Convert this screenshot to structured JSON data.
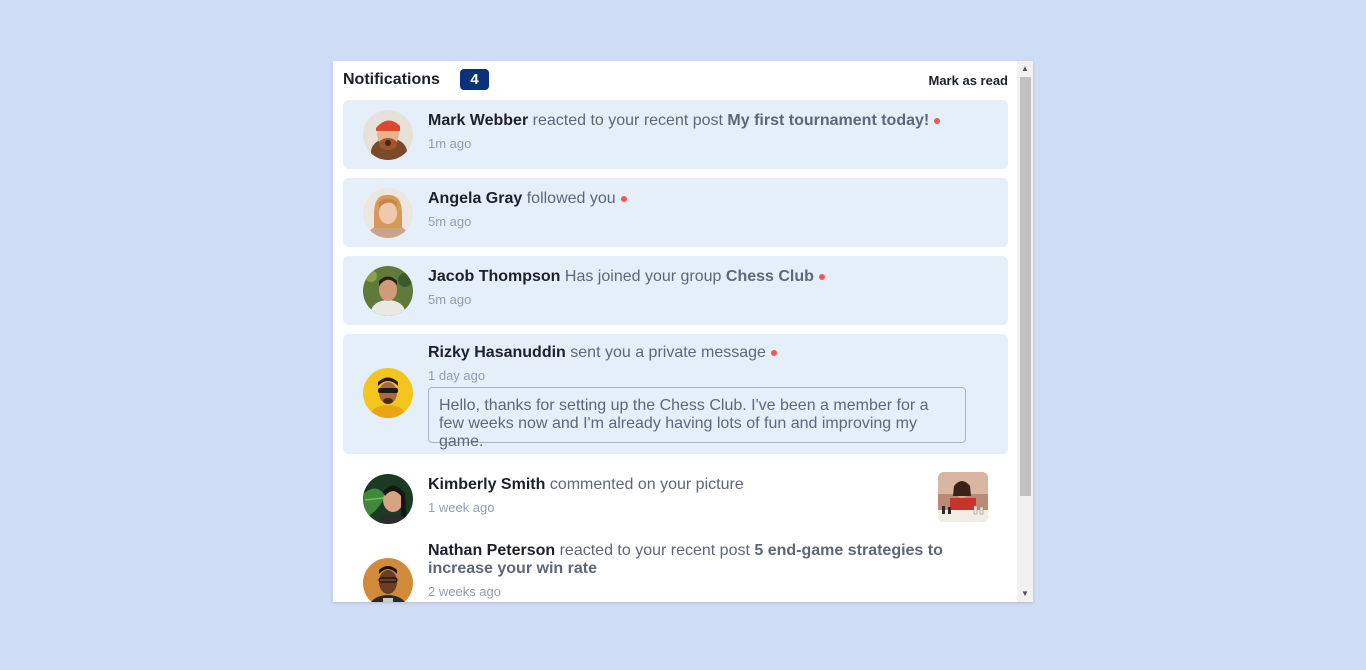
{
  "header": {
    "title": "Notifications",
    "unread_count": "4",
    "mark_read_label": "Mark as read"
  },
  "colors": {
    "background": "#cfdcf6",
    "unread_bg": "#e5effa",
    "badge": "#0a327b",
    "dot": "#f65552",
    "dark_text": "#1c202b",
    "muted_text": "#5e6778"
  },
  "notifications": [
    {
      "name": "Mark Webber",
      "action": "reacted to your recent post",
      "target": "My first tournament today!",
      "time": "1m ago",
      "unread": true
    },
    {
      "name": "Angela Gray",
      "action": "followed you",
      "target": "",
      "time": "5m ago",
      "unread": true
    },
    {
      "name": "Jacob Thompson",
      "action": "Has joined your group",
      "target": "Chess Club",
      "time": "5m ago",
      "unread": true
    },
    {
      "name": "Rizky Hasanuddin",
      "action": "sent you a private message",
      "target": "",
      "time": "1 day ago",
      "unread": true,
      "message": "Hello, thanks for setting up the Chess Club. I've been a member for a few weeks now and I'm already having lots of fun and improving my game."
    },
    {
      "name": "Kimberly Smith",
      "action": "commented on your picture",
      "target": "",
      "time": "1 week ago",
      "unread": false
    },
    {
      "name": "Nathan Peterson",
      "action": "reacted to your recent post",
      "target": "5 end-game strategies to increase your win rate",
      "time": "2 weeks ago",
      "unread": false
    }
  ]
}
